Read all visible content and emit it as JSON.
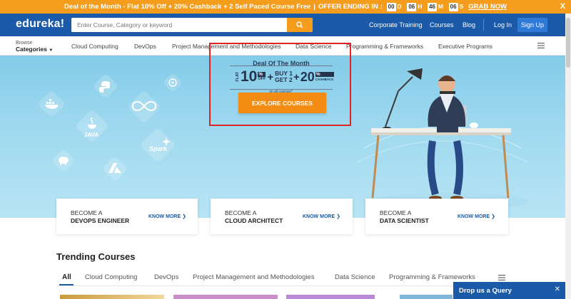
{
  "promo": {
    "text": "Deal of the Month - Flat 10% Off + 20% Cashback + 2 Self Paced Course Free",
    "sep": "|",
    "offer": "OFFER ENDING IN :",
    "countdown": [
      {
        "value": "00",
        "unit": "D"
      },
      {
        "value": "06",
        "unit": "H"
      },
      {
        "value": "46",
        "unit": "M"
      },
      {
        "value": "06",
        "unit": "S"
      }
    ],
    "cta": "GRAB NOW",
    "close": "X"
  },
  "header": {
    "logo": "edureka!",
    "search_placeholder": "Enter Course, Category or keyword",
    "nav": [
      "Corporate Training",
      "Courses",
      "Blog"
    ],
    "login": "Log In",
    "signup": "Sign Up"
  },
  "catnav": {
    "browse_line1": "Browse",
    "browse_line2": "Categories",
    "items": [
      "Cloud Computing",
      "DevOps",
      "Project Management and Methodologies",
      "Data Science",
      "Programming & Frameworks",
      "Executive Programs"
    ]
  },
  "hero": {
    "tech_labels": {
      "java": "JAVA",
      "spark": "Spark"
    },
    "deal_title": "Deal Of The Month",
    "flat": "FLAT",
    "ten": "10",
    "pct": "%",
    "off": "OFF",
    "plus": "+",
    "buy": "BUY 1",
    "get": "GET 2",
    "twenty": "20",
    "cashback": "CASHBACK",
    "note": "on all courses*",
    "cta": "EXPLORE COURSES"
  },
  "cards": [
    {
      "line1": "BECOME A",
      "line2": "DEVOPS ENGINEER",
      "link": "KNOW MORE"
    },
    {
      "line1": "BECOME A",
      "line2": "CLOUD ARCHITECT",
      "link": "KNOW MORE"
    },
    {
      "line1": "BECOME A",
      "line2": "DATA SCIENTIST",
      "link": "KNOW MORE"
    }
  ],
  "trending": {
    "title": "Trending Courses",
    "tabs": [
      "All",
      "Cloud Computing",
      "DevOps",
      "Project Management and Methodologies",
      "Data Science",
      "Programming & Frameworks"
    ]
  },
  "drop": {
    "label": "Drop us a Query",
    "close": "✕"
  },
  "colors": {
    "brand": "#1a5aa8",
    "accent": "#f49d1d",
    "cta": "#f48b12",
    "highlight": "#e02424"
  }
}
